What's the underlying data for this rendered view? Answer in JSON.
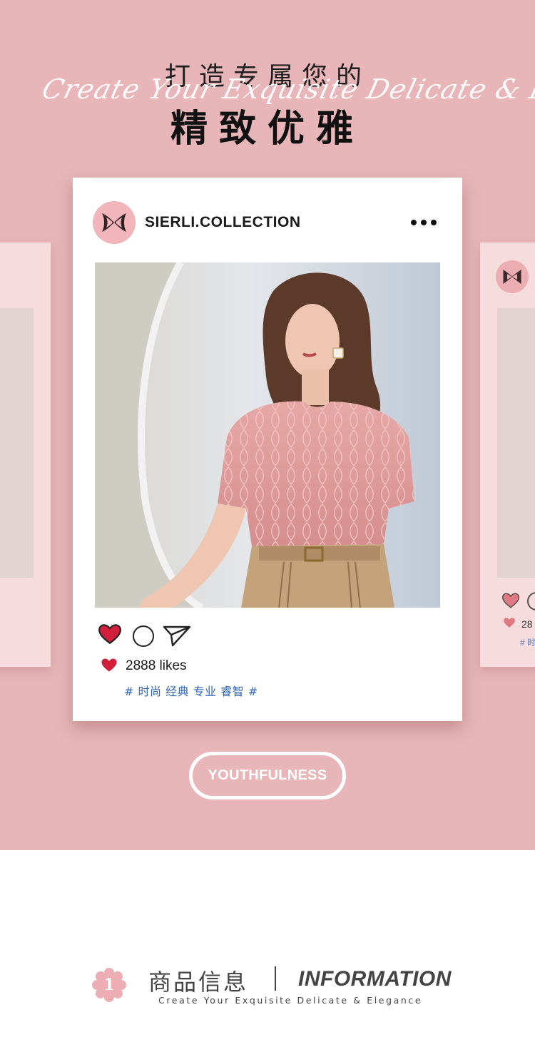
{
  "headline": {
    "line1": "打造专属您的",
    "script": "Create Your Exquisite Delicate & Elegance",
    "line2": "精致优雅"
  },
  "post": {
    "handle": "SIERLI.COLLECTION",
    "likes": "2888 likes",
    "hashtags": "# 时尚 经典 专业 睿智 #",
    "icons": [
      "heart-icon",
      "comment-icon",
      "share-icon",
      "more-icon"
    ]
  },
  "side_card_right": {
    "likes": "28",
    "hashtags": "# 时"
  },
  "cta": {
    "label": "YOUTHFULNESS"
  },
  "section": {
    "number": "1",
    "title_cn": "商品信息",
    "title_en": "INFORMATION",
    "subtitle": "Create Your Exquisite Delicate & Elegance"
  },
  "colors": {
    "hero_bg": "#e8b6b8",
    "avatar_bg": "#f1b5ba",
    "heart_red": "#d21f3c",
    "hashtag_blue": "#2d66b8",
    "card_bg": "#ffffff",
    "side_card_bg": "#f6dcdd"
  }
}
